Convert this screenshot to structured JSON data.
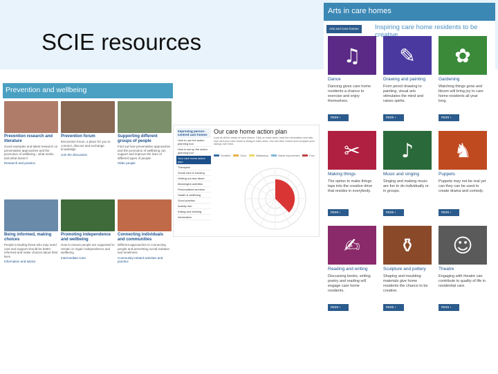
{
  "slide": {
    "title": "SCIE resources"
  },
  "prevention": {
    "header": "Prevention and wellbeing",
    "cards": [
      {
        "title": "Prevention research and literature",
        "desc": "Good examples and latest research on preventative approaches and the promotion of wellbeing - what works and what doesn't",
        "link": "Research and practice",
        "color": "#b07c6a"
      },
      {
        "title": "Prevention forum",
        "desc": "Discussion forum, a place for you to connect, discuss and exchange knowledge",
        "link": "Join the discussion",
        "color": "#8a6a55"
      },
      {
        "title": "Supporting different groups of people",
        "desc": "Find out how preventative approaches and the promotion of wellbeing can support and improve the lives of different types of people",
        "link": "Older people",
        "color": "#7a8e6a"
      },
      {
        "title": "Being informed, making choices",
        "desc": "People including those who may need care and support should be better informed and make choices about their lives",
        "link": "Information and advice",
        "color": "#6a8aaa"
      },
      {
        "title": "Promoting independence and wellbeing",
        "desc": "How to ensure people are supported to remain or regain independence and wellbeing",
        "link": "Intermediate Care",
        "color": "#3f6a3a"
      },
      {
        "title": "Connecting individuals and communities",
        "desc": "Different approaches to connecting people and preventing social isolation and loneliness",
        "link": "Community-related activities and practice",
        "color": "#c06a4a"
      }
    ]
  },
  "plan": {
    "nav_header": "Improving person-centred care homes",
    "nav_items": [
      "How to use the action planning tool",
      "How to set up the action planning tool",
      "Your care home action plan",
      "Therapies",
      "Social care & housing",
      "Getting out and about",
      "Meaningful activities",
      "Personalised services",
      "Health & wellbeing",
      "Good practice",
      "Activity hub",
      "Eating and drinking",
      "Information"
    ],
    "selected_index": 2,
    "title": "Our care home action plan",
    "text": "Look at all the areas of care shown. Click on each area, read the information and rate how well your care home is doing in each area. You can then review and compare your ratings over time.",
    "legend": [
      "Excellent",
      "Good",
      "Satisfactory",
      "Needs improvement",
      "Poor"
    ],
    "legend_colors": [
      "#3b6ea5",
      "#e8b04a",
      "#e8d86a",
      "#7fb8d8",
      "#c04040"
    ],
    "chart_value": 0.14
  },
  "arts": {
    "header": "Arts in care homes",
    "sub_button": "Arts and Care homes",
    "tagline": "Inspiring care home residents to be creative",
    "tiles": [
      {
        "name": "Dance",
        "desc": "Dancing gives care home residents a chance to exercise and enjoy themselves.",
        "more": "more",
        "color": "#5b2a86",
        "icon": "dance-icon",
        "glyph": "♫"
      },
      {
        "name": "Drawing and painting",
        "desc": "From pencil drawing to painting, visual arts stimulates the mind and raises spirits.",
        "more": "more",
        "color": "#4a3aa0",
        "icon": "paint-brush-icon",
        "glyph": "✎"
      },
      {
        "name": "Gardening",
        "desc": "Watching things grow and bloom will bring joy to care home residents all year long.",
        "more": "more",
        "color": "#3a8a3a",
        "icon": "watering-can-icon",
        "glyph": "✿"
      },
      {
        "name": "Making things",
        "desc": "The option to make things taps into the creative drive that resides in everybody.",
        "more": "more",
        "color": "#b02040",
        "icon": "beads-icon",
        "glyph": "✂"
      },
      {
        "name": "Music and singing",
        "desc": "Singing and making music are fun to do individually or in groups.",
        "more": "more",
        "color": "#2a6a3a",
        "icon": "guitar-icon",
        "glyph": "♪"
      },
      {
        "name": "Puppets",
        "desc": "Puppets may not be real yet can they can be used to create drama and comedy.",
        "more": "more",
        "color": "#c04a20",
        "icon": "puppet-icon",
        "glyph": "♞"
      },
      {
        "name": "Reading and writing",
        "desc": "Discussing books, writing poetry and reading will engage care home residents.",
        "more": "more",
        "color": "#8a2a6a",
        "icon": "book-icon",
        "glyph": "✍"
      },
      {
        "name": "Sculpture and pottery",
        "desc": "Shaping and moulding materials give home residents the chance to be creative.",
        "more": "more",
        "color": "#8a4a2a",
        "icon": "pottery-icon",
        "glyph": "⚱"
      },
      {
        "name": "Theatre",
        "desc": "Engaging with theatre can contribute to quality of life in residential care.",
        "more": "more",
        "color": "#5a5a5a",
        "icon": "theatre-masks-icon",
        "glyph": "☺"
      }
    ]
  }
}
